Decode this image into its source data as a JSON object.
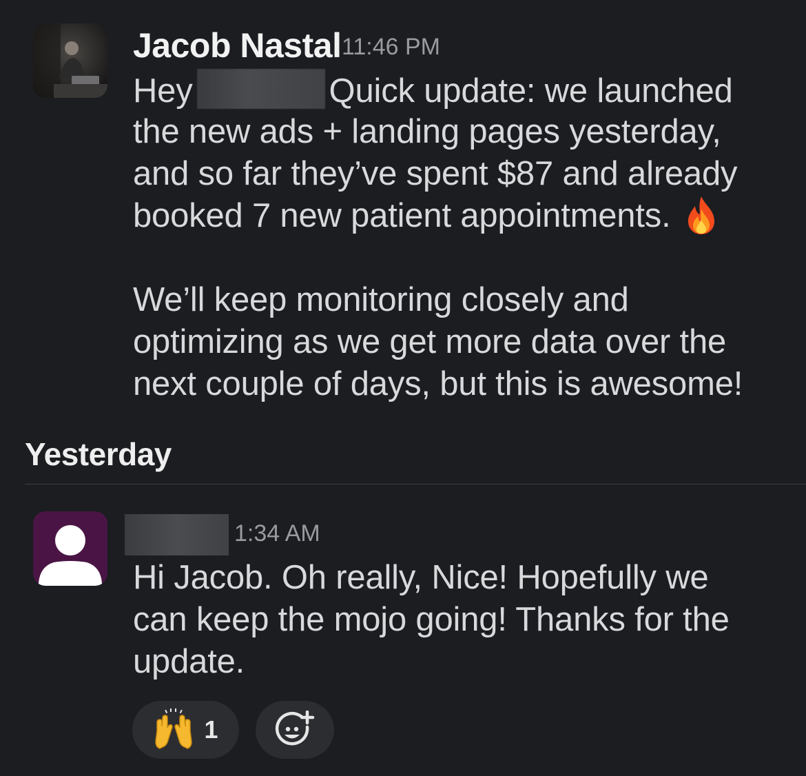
{
  "message1": {
    "sender": "Jacob Nastal",
    "timestamp": "11:46 PM",
    "line1_start": "Hey",
    "line1_end": "Quick update: we launched",
    "line2": "the new ads + landing pages yesterday,",
    "line3": "and so far they’ve spent $87 and already",
    "line4": "booked 7 new patient appointments.",
    "line4_emoji": "fire-emoji",
    "para2_line1": "We’ll keep monitoring closely and",
    "para2_line2": "optimizing as we get more data over the",
    "para2_line3": "next couple of days, but this is awesome!"
  },
  "date_divider": {
    "label": "Yesterday"
  },
  "message2": {
    "timestamp": "1:34 AM",
    "line1": "Hi Jacob. Oh really, Nice! Hopefully we",
    "line2": "can keep the mojo going! Thanks for the",
    "line3": "update."
  },
  "reactions": [
    {
      "emoji": "raising-hands-emoji",
      "count": "1"
    }
  ],
  "add_reaction_icon": "add-emoji-icon",
  "colors": {
    "background": "#1b1d21",
    "text": "#d8d9da",
    "timestamp": "#9a9b9d",
    "avatar2_bg": "#4a1545",
    "reaction_bg": "#2c2d31"
  }
}
